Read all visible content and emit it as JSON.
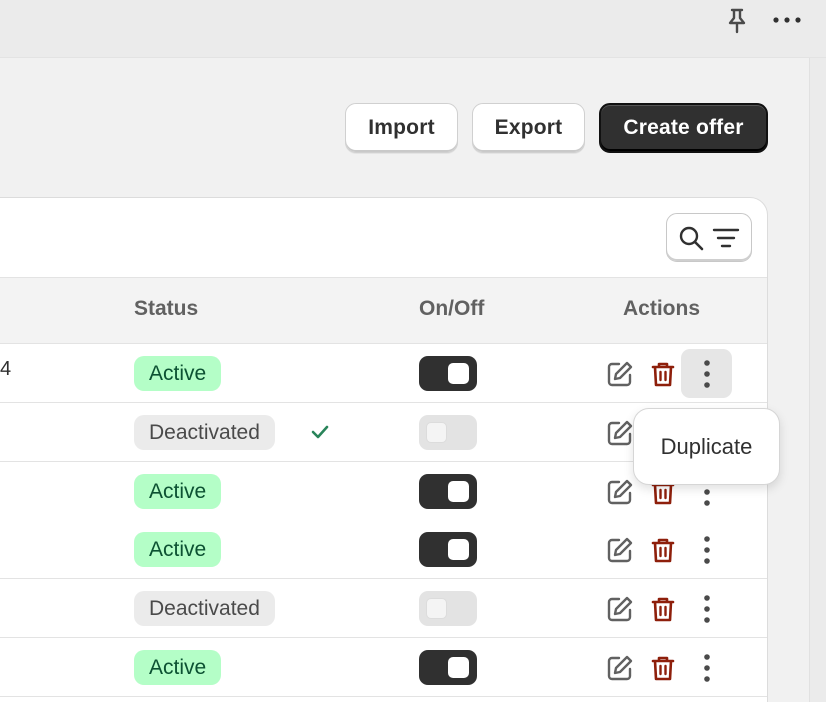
{
  "toolbar": {
    "import_label": "Import",
    "export_label": "Export",
    "create_label": "Create offer"
  },
  "table": {
    "headers": {
      "status": "Status",
      "onoff": "On/Off",
      "actions": "Actions"
    },
    "rows": [
      {
        "edge_text": "4",
        "status": "Active",
        "state": "active",
        "toggle_on": true
      },
      {
        "edge_text": "",
        "status": "Deactivated",
        "state": "deactivated",
        "toggle_on": false
      },
      {
        "edge_text": "",
        "status": "Active",
        "state": "active",
        "toggle_on": true
      },
      {
        "edge_text": "",
        "status": "Active",
        "state": "active",
        "toggle_on": true
      },
      {
        "edge_text": "",
        "status": "Deactivated",
        "state": "deactivated",
        "toggle_on": false
      },
      {
        "edge_text": "",
        "status": "Active",
        "state": "active",
        "toggle_on": true
      }
    ]
  },
  "popover": {
    "duplicate_label": "Duplicate"
  },
  "icons": {
    "topbar": [
      "pin-icon",
      "more-horizontal-icon"
    ],
    "search": "search-icon",
    "filter": "filter-icon",
    "edit": "edit-icon",
    "delete": "trash-icon",
    "row_menu": "more-vertical-icon",
    "saved": "checkmark-icon"
  },
  "colors": {
    "primary_button": "#303030",
    "active_badge_bg": "#b4fec7",
    "active_badge_text": "#0c5132",
    "deactivated_badge_bg": "#ebebeb",
    "trash": "#8e1f0b",
    "checkmark": "#29845a"
  }
}
